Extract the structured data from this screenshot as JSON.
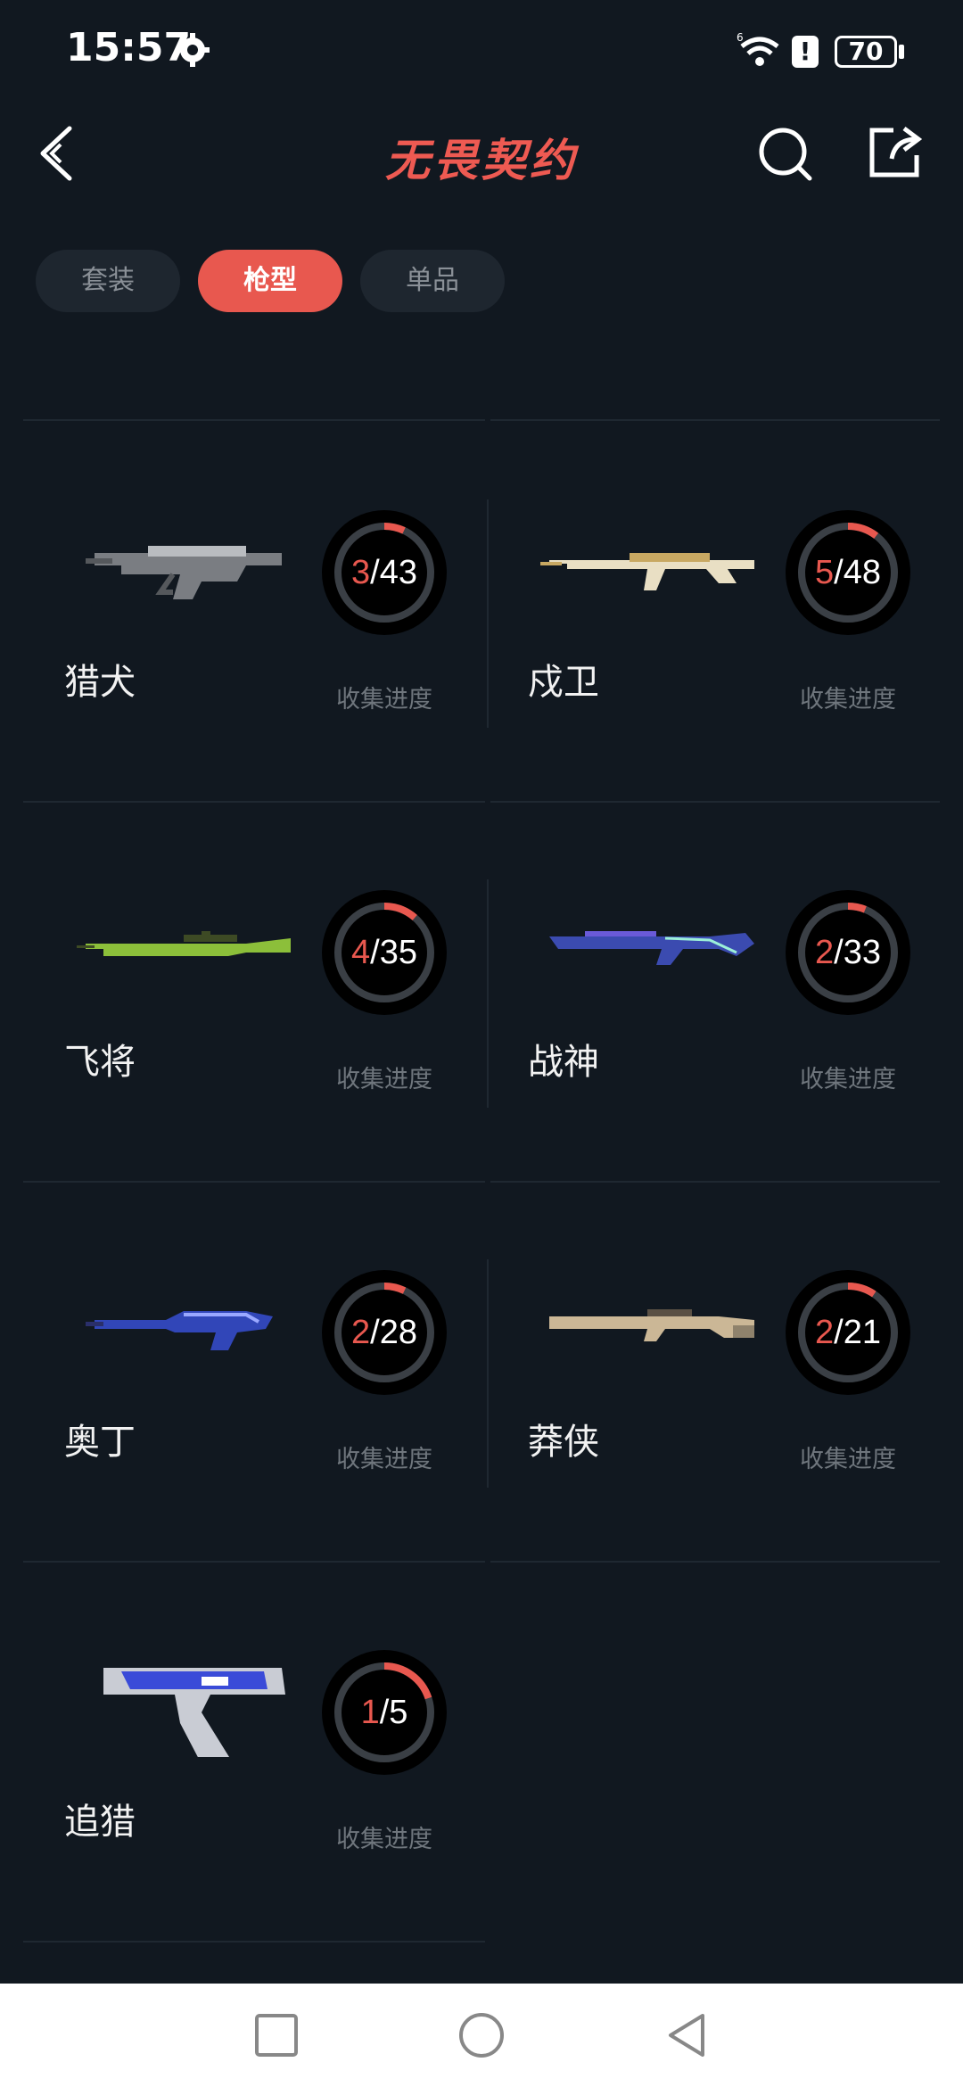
{
  "status": {
    "time": "15:57",
    "network": "6",
    "battery": "70"
  },
  "header": {
    "title": "无畏契约"
  },
  "tabs": [
    {
      "label": "套装",
      "active": false
    },
    {
      "label": "枪型",
      "active": true
    },
    {
      "label": "单品",
      "active": false
    }
  ],
  "collection_label": "收集进度",
  "weapons": [
    {
      "name": "猎犬",
      "collected": 3,
      "total": 43,
      "got": "3",
      "all": "/43"
    },
    {
      "name": "戍卫",
      "collected": 5,
      "total": 48,
      "got": "5",
      "all": "/48"
    },
    {
      "name": "飞将",
      "collected": 4,
      "total": 35,
      "got": "4",
      "all": "/35"
    },
    {
      "name": "战神",
      "collected": 2,
      "total": 33,
      "got": "2",
      "all": "/33"
    },
    {
      "name": "奥丁",
      "collected": 2,
      "total": 28,
      "got": "2",
      "all": "/28"
    },
    {
      "name": "莽侠",
      "collected": 2,
      "total": 21,
      "got": "2",
      "all": "/21"
    },
    {
      "name": "追猎",
      "collected": 1,
      "total": 5,
      "got": "1",
      "all": "/5"
    }
  ],
  "colors": {
    "accent": "#e8584f",
    "background": "#111820",
    "ring_track": "#3a3f45"
  }
}
